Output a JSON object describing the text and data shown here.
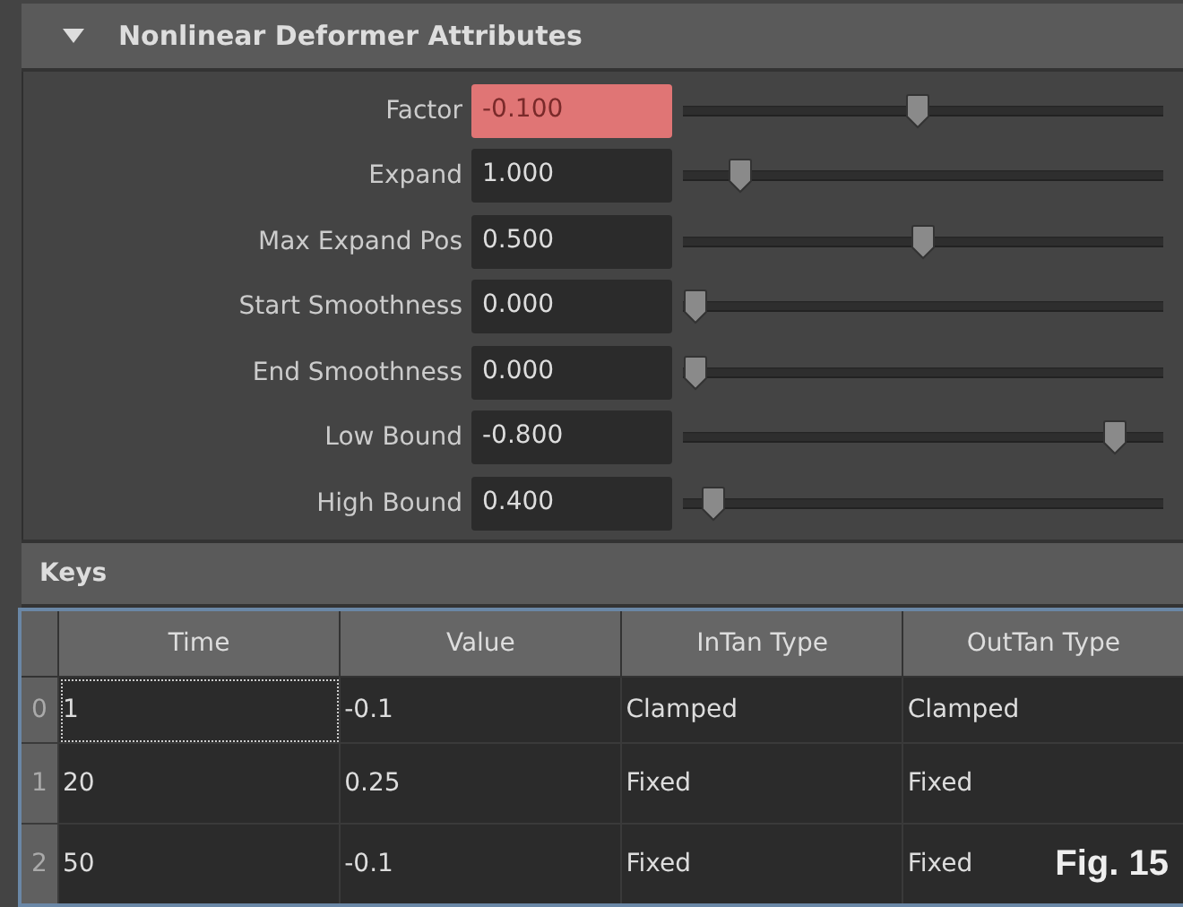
{
  "section": {
    "title": "Nonlinear Deformer Attributes",
    "expanded": true
  },
  "attributes": [
    {
      "label": "Factor",
      "value": "-0.100",
      "highlighted": true,
      "level": 0.49
    },
    {
      "label": "Expand",
      "value": "1.000",
      "highlighted": false,
      "level": 0.1
    },
    {
      "label": "Max Expand Pos",
      "value": "0.500",
      "highlighted": false,
      "level": 0.5
    },
    {
      "label": "Start Smoothness",
      "value": "0.000",
      "highlighted": false,
      "level": 0.0
    },
    {
      "label": "End Smoothness",
      "value": "0.000",
      "highlighted": false,
      "level": 0.0
    },
    {
      "label": "Low Bound",
      "value": "-0.800",
      "highlighted": false,
      "level": 0.92
    },
    {
      "label": "High Bound",
      "value": "0.400",
      "highlighted": false,
      "level": 0.04
    }
  ],
  "keys": {
    "title": "Keys",
    "columns": [
      "Time",
      "Value",
      "InTan Type",
      "OutTan Type"
    ],
    "rows": [
      {
        "index": "0",
        "cells": [
          "1",
          "-0.1",
          "Clamped",
          "Clamped"
        ],
        "focused": true
      },
      {
        "index": "1",
        "cells": [
          "20",
          "0.25",
          "Fixed",
          "Fixed"
        ],
        "focused": false
      },
      {
        "index": "2",
        "cells": [
          "50",
          "-0.1",
          "Fixed",
          "Fixed"
        ],
        "focused": false
      }
    ]
  },
  "figure_label": "Fig. 15"
}
